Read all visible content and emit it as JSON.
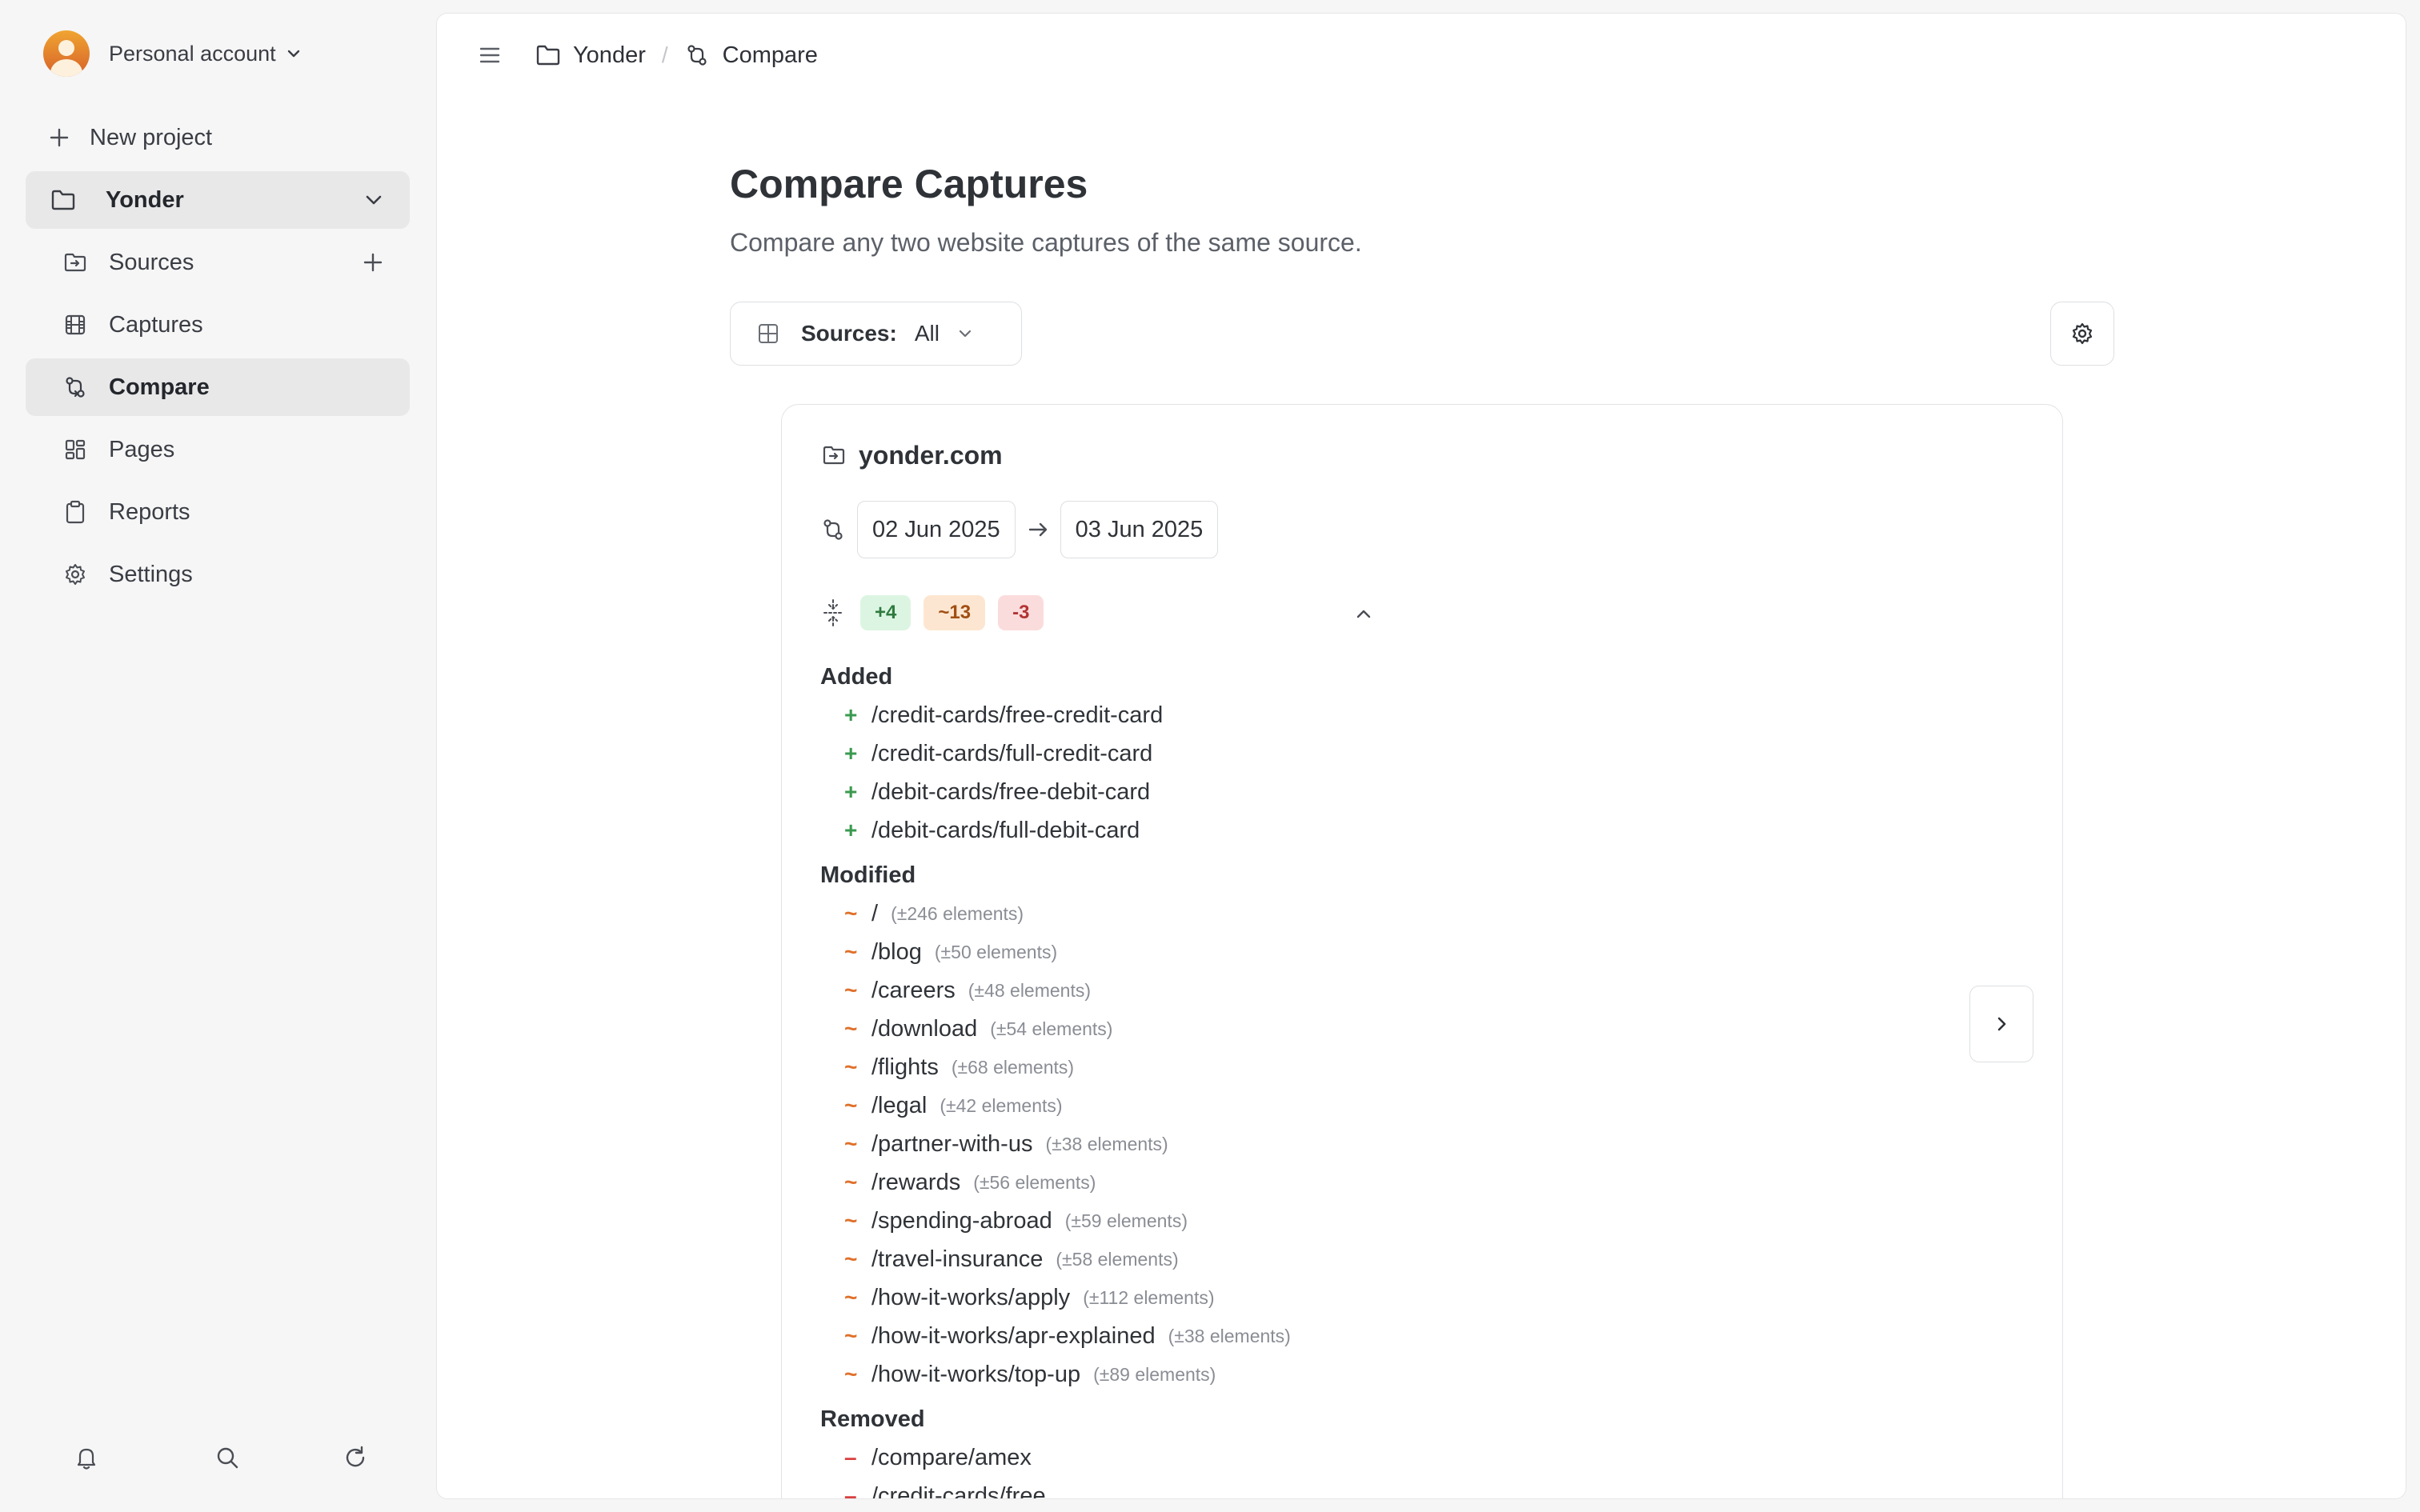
{
  "sidebar": {
    "account": {
      "label": "Personal account"
    },
    "new_project": {
      "label": "New project"
    },
    "project": {
      "label": "Yonder"
    },
    "items": [
      {
        "label": "Sources",
        "icon": "sources-icon"
      },
      {
        "label": "Captures",
        "icon": "film-icon"
      },
      {
        "label": "Compare",
        "icon": "compare-icon",
        "active": true
      },
      {
        "label": "Pages",
        "icon": "grid-icon"
      },
      {
        "label": "Reports",
        "icon": "clipboard-icon"
      },
      {
        "label": "Settings",
        "icon": "gear-icon"
      }
    ],
    "bottom_icons": [
      "bell-icon",
      "search-icon",
      "refresh-icon"
    ]
  },
  "breadcrumb": {
    "project": "Yonder",
    "separator": "/",
    "page": "Compare"
  },
  "header": {
    "title": "Compare Captures",
    "subtitle": "Compare any two website captures of the same source."
  },
  "filter": {
    "label": "Sources:",
    "value": "All"
  },
  "card": {
    "source": "yonder.com",
    "from_date": "02 Jun 2025",
    "to_date": "03 Jun 2025",
    "badges": {
      "added": "+4",
      "modified": "~13",
      "removed": "-3"
    },
    "sections": {
      "added": {
        "title": "Added",
        "symbol": "+",
        "items": [
          {
            "path": "/credit-cards/free-credit-card"
          },
          {
            "path": "/credit-cards/full-credit-card"
          },
          {
            "path": "/debit-cards/free-debit-card"
          },
          {
            "path": "/debit-cards/full-debit-card"
          }
        ]
      },
      "modified": {
        "title": "Modified",
        "symbol": "~",
        "items": [
          {
            "path": "/",
            "count": "(±246 elements)"
          },
          {
            "path": "/blog",
            "count": "(±50 elements)"
          },
          {
            "path": "/careers",
            "count": "(±48 elements)"
          },
          {
            "path": "/download",
            "count": "(±54 elements)"
          },
          {
            "path": "/flights",
            "count": "(±68 elements)"
          },
          {
            "path": "/legal",
            "count": "(±42 elements)"
          },
          {
            "path": "/partner-with-us",
            "count": "(±38 elements)"
          },
          {
            "path": "/rewards",
            "count": "(±56 elements)"
          },
          {
            "path": "/spending-abroad",
            "count": "(±59 elements)"
          },
          {
            "path": "/travel-insurance",
            "count": "(±58 elements)"
          },
          {
            "path": "/how-it-works/apply",
            "count": "(±112 elements)"
          },
          {
            "path": "/how-it-works/apr-explained",
            "count": "(±38 elements)"
          },
          {
            "path": "/how-it-works/top-up",
            "count": "(±89 elements)"
          }
        ]
      },
      "removed": {
        "title": "Removed",
        "symbol": "–",
        "items": [
          {
            "path": "/compare/amex"
          },
          {
            "path": "/credit-cards/free"
          }
        ]
      }
    }
  }
}
